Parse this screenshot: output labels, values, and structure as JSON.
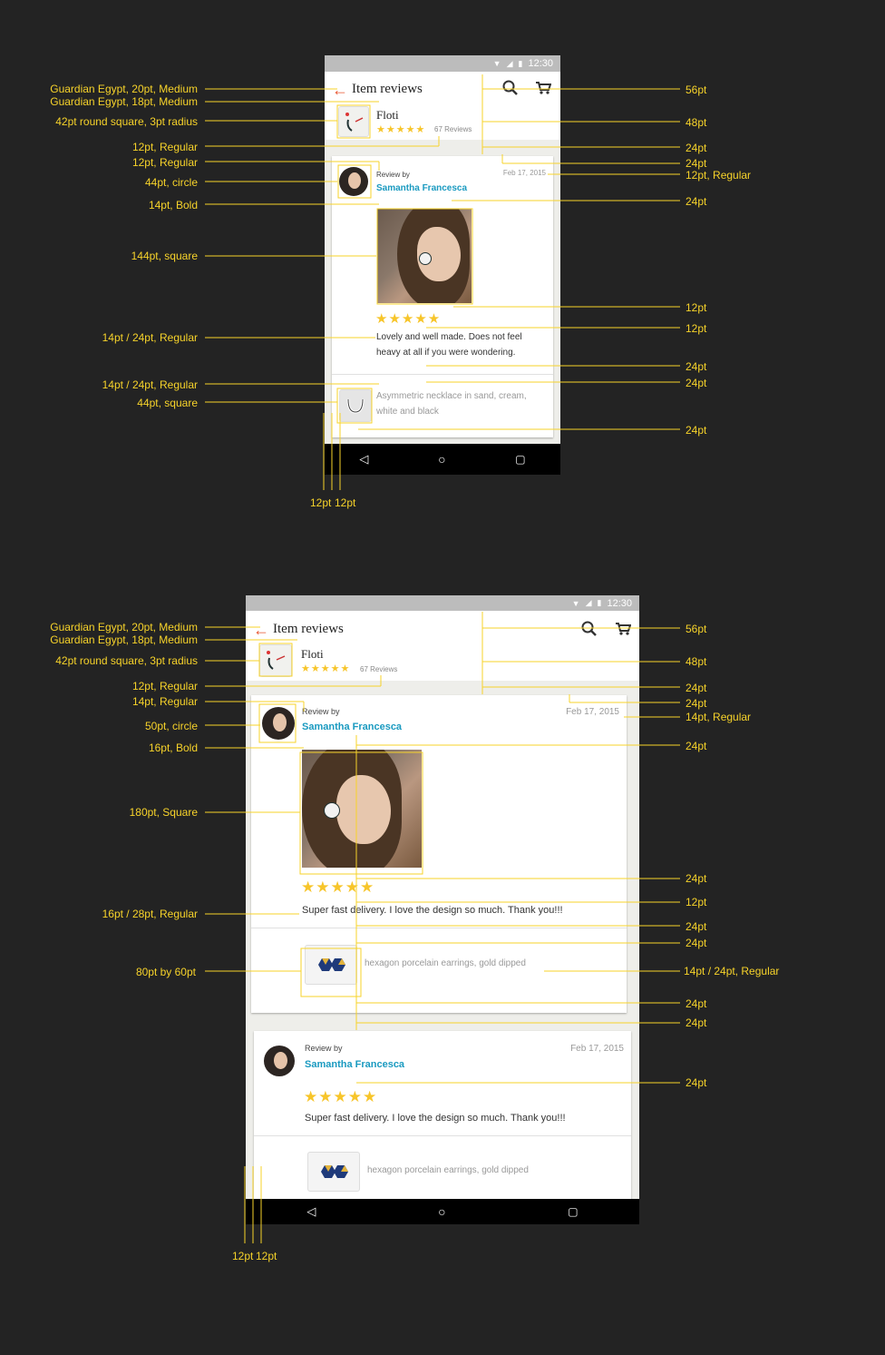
{
  "status": {
    "time": "12:30"
  },
  "header": {
    "title": "Item reviews",
    "back_icon": "arrow-left-icon",
    "search_icon": "search-icon",
    "cart_icon": "cart-icon"
  },
  "shop": {
    "name": "Floti",
    "stars": "★★★★★",
    "reviews": "67 Reviews"
  },
  "review": {
    "by": "Review by",
    "author": "Samantha Francesca",
    "date": "Feb 17, 2015",
    "stars": "★★★★★",
    "text_small": "Lovely and well made. Does not feel heavy at all if you were wondering.",
    "item_small": "Asymmetric necklace in sand, cream, white and black",
    "text_large": "Super fast delivery. I love the design so much. Thank you!!!",
    "item_large": "hexagon porcelain earrings, gold dipped"
  },
  "colors": {
    "accent": "#f7d32a",
    "link": "#1a9ac0",
    "back_arrow": "#e8542f"
  },
  "annotations": {
    "top_left": [
      "Guardian Egypt, 20pt, Medium",
      "Guardian Egypt, 18pt, Medium",
      "42pt round square, 3pt radius",
      "12pt, Regular",
      "12pt, Regular",
      "44pt, circle",
      "14pt, Bold",
      "144pt, square",
      "14pt / 24pt, Regular",
      "14pt / 24pt, Regular",
      "44pt, square"
    ],
    "top_right": [
      "56pt",
      "48pt",
      "24pt",
      "24pt",
      "12pt, Regular",
      "24pt",
      "12pt",
      "12pt",
      "24pt",
      "24pt",
      "24pt"
    ],
    "top_bottom": [
      "12pt",
      "12pt"
    ],
    "bottom_left": [
      "Guardian Egypt, 20pt, Medium",
      "Guardian Egypt, 18pt, Medium",
      "42pt round square, 3pt radius",
      "12pt, Regular",
      "14pt, Regular",
      "50pt, circle",
      "16pt, Bold",
      "180pt, Square",
      "16pt / 28pt, Regular",
      "80pt by 60pt"
    ],
    "bottom_right": [
      "56pt",
      "48pt",
      "24pt",
      "24pt",
      "14pt, Regular",
      "24pt",
      "24pt",
      "12pt",
      "24pt",
      "24pt",
      "14pt / 24pt, Regular",
      "24pt",
      "24pt",
      "24pt"
    ],
    "bottom_bottom": [
      "12pt",
      "12pt"
    ]
  }
}
